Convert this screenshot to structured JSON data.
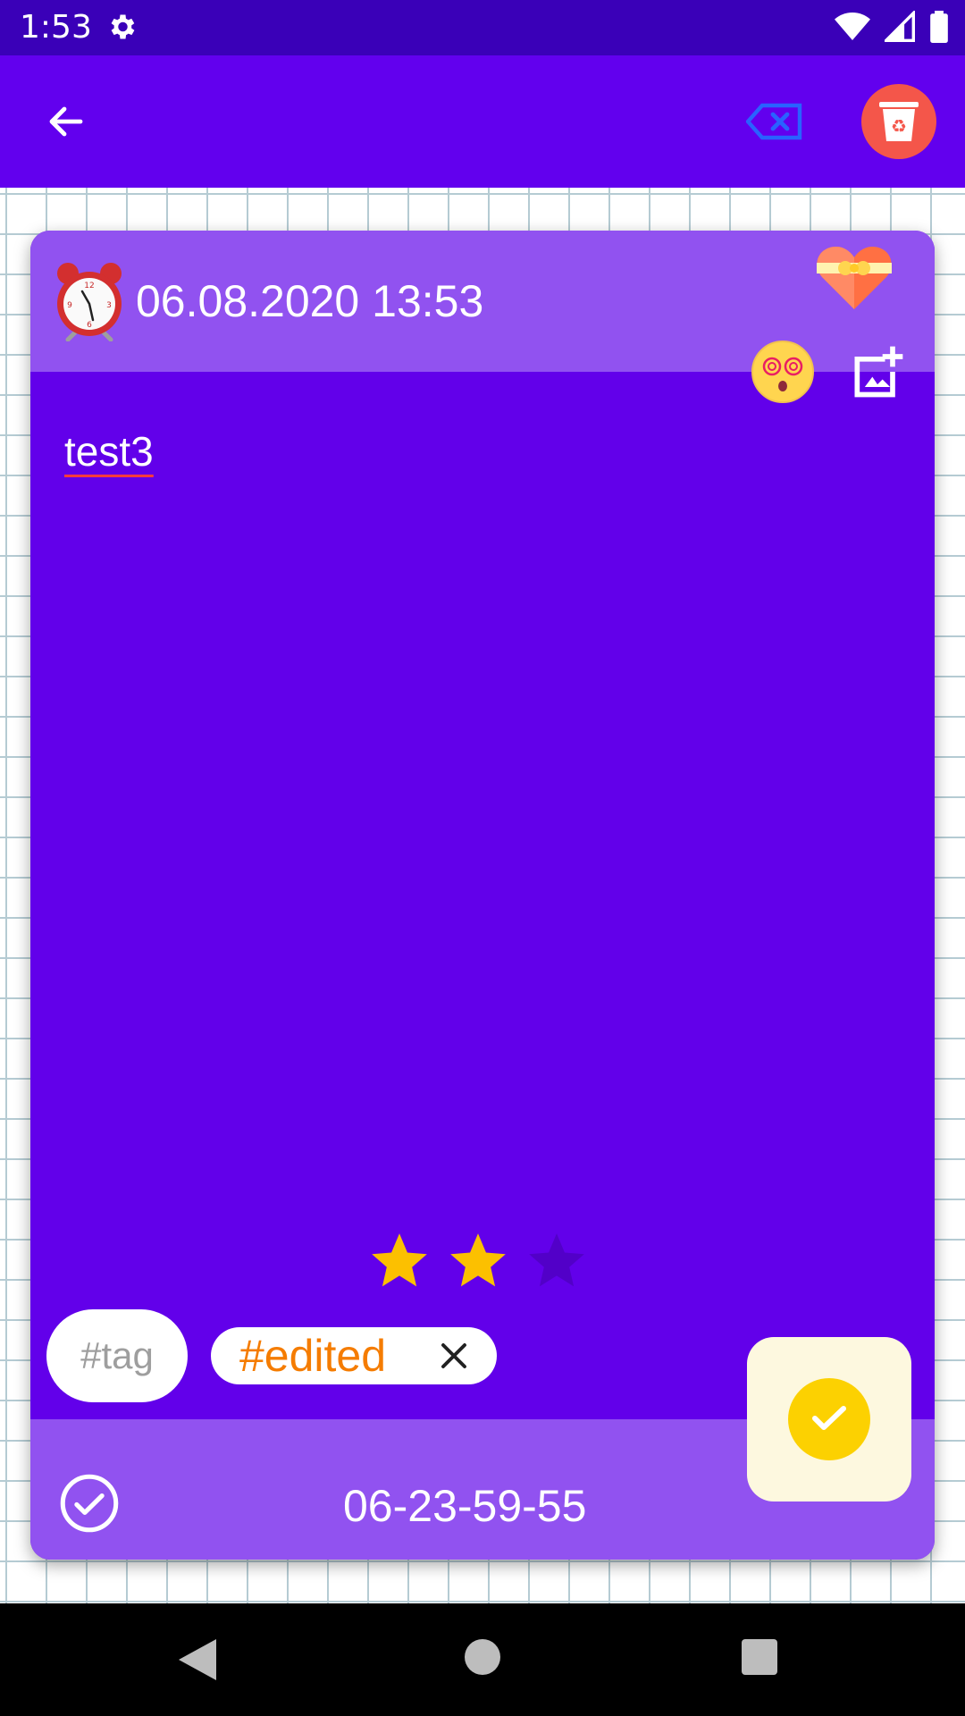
{
  "status_bar": {
    "time": "1:53",
    "icons": [
      "settings-icon",
      "wifi-icon",
      "signal-icon",
      "battery-icon"
    ]
  },
  "app_bar": {
    "background": "#6200ee",
    "back_icon": "arrow-back-icon",
    "clear_tags_icon": "backspace-tag-icon",
    "delete_icon": "recycle-bin-icon"
  },
  "note": {
    "date_time": "06.08.2020 13:53",
    "text": "test3",
    "mood_icon": "dizzy-face-emoji",
    "favorite_icon": "heart-with-ribbon-icon",
    "add_image_icon": "add-photo-icon",
    "rating": {
      "value": 2,
      "max": 3
    },
    "tag_placeholder": "#tag",
    "tags": [
      {
        "label": "#edited"
      }
    ],
    "footer_code": "06-23-59-55",
    "colors": {
      "card_background": "#6200ea",
      "header_footer": "#9152f0",
      "star_active": "#fcc000",
      "star_inactive": "#5200c8",
      "tag_text": "#f57c00",
      "confirm": "#fcd101"
    }
  },
  "nav_bar": {
    "icons": [
      "nav-back-icon",
      "nav-home-icon",
      "nav-recents-icon"
    ]
  }
}
